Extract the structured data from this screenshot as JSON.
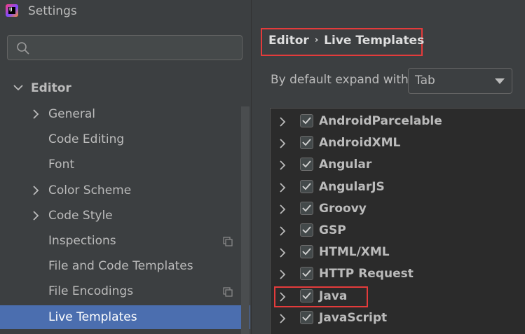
{
  "window": {
    "title": "Settings"
  },
  "sidebar": {
    "search_placeholder": "",
    "root": {
      "label": "Editor"
    },
    "items": [
      {
        "label": "General",
        "expandable": true,
        "copy_icon": false
      },
      {
        "label": "Code Editing",
        "expandable": false,
        "copy_icon": false
      },
      {
        "label": "Font",
        "expandable": false,
        "copy_icon": false
      },
      {
        "label": "Color Scheme",
        "expandable": true,
        "copy_icon": false
      },
      {
        "label": "Code Style",
        "expandable": true,
        "copy_icon": false
      },
      {
        "label": "Inspections",
        "expandable": false,
        "copy_icon": true
      },
      {
        "label": "File and Code Templates",
        "expandable": false,
        "copy_icon": false
      },
      {
        "label": "File Encodings",
        "expandable": false,
        "copy_icon": true
      },
      {
        "label": "Live Templates",
        "expandable": false,
        "copy_icon": false,
        "selected": true
      }
    ]
  },
  "main": {
    "breadcrumb": {
      "parent": "Editor",
      "current": "Live Templates"
    },
    "expand_with": {
      "label": "By default expand with",
      "value": "Tab"
    },
    "template_groups": [
      {
        "label": "AndroidParcelable",
        "checked": true
      },
      {
        "label": "AndroidXML",
        "checked": true
      },
      {
        "label": "Angular",
        "checked": true
      },
      {
        "label": "AngularJS",
        "checked": true
      },
      {
        "label": "Groovy",
        "checked": true
      },
      {
        "label": "GSP",
        "checked": true
      },
      {
        "label": "HTML/XML",
        "checked": true
      },
      {
        "label": "HTTP Request",
        "checked": true
      },
      {
        "label": "Java",
        "checked": true
      },
      {
        "label": "JavaScript",
        "checked": true
      }
    ]
  },
  "colors": {
    "background": "#3c3f41",
    "selection": "#4b6eaf",
    "highlight_box": "#e43b3b",
    "tree_background": "#2b2b2b"
  }
}
